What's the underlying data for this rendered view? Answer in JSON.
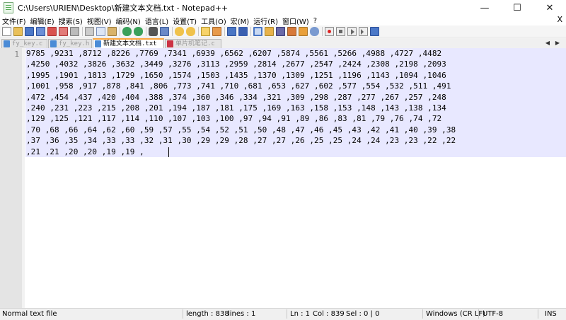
{
  "window": {
    "title": "C:\\Users\\URIEN\\Desktop\\新建文本文档.txt - Notepad++",
    "minimize_glyph": "—",
    "maximize_glyph": "☐",
    "close_glyph": "✕"
  },
  "menu": {
    "items": [
      "文件(F)",
      "编辑(E)",
      "搜索(S)",
      "视图(V)",
      "编码(N)",
      "语言(L)",
      "设置(T)",
      "工具(O)",
      "宏(M)",
      "运行(R)",
      "窗口(W)",
      "?"
    ],
    "close_glyph": "X"
  },
  "toolbar": {
    "icons": [
      "new-file-icon",
      "open-file-icon",
      "save-icon",
      "save-all-icon",
      "close-icon",
      "close-all-icon",
      "print-icon",
      "cut-icon",
      "copy-icon",
      "paste-icon",
      "undo-icon",
      "redo-icon",
      "find-icon",
      "replace-icon",
      "zoom-in-icon",
      "zoom-out-icon",
      "sync-vertical-icon",
      "sync-horizontal-icon",
      "word-wrap-icon",
      "show-all-chars-icon",
      "indent-guide-icon",
      "udl-icon",
      "doc-map-icon",
      "function-list-icon",
      "folder-icon",
      "monitor-icon",
      "record-macro-icon",
      "stop-record-icon",
      "play-macro-icon",
      "run-macro-multiple-icon",
      "save-macro-icon"
    ]
  },
  "tabs": [
    {
      "label": "fy_key.c",
      "active": false
    },
    {
      "label": "fy_key.h",
      "active": false
    },
    {
      "label": "新建文本文档.txt",
      "active": true
    },
    {
      "label": "单片机笔记.c",
      "active": false
    }
  ],
  "editor": {
    "line_number": "1",
    "lines": [
      "9785 ,9231 ,8712 ,8226 ,7769 ,7341 ,6939 ,6562 ,6207 ,5874 ,5561 ,5266 ,4988 ,4727 ,4482",
      ",4250 ,4032 ,3826 ,3632 ,3449 ,3276 ,3113 ,2959 ,2814 ,2677 ,2547 ,2424 ,2308 ,2198 ,2093",
      ",1995 ,1901 ,1813 ,1729 ,1650 ,1574 ,1503 ,1435 ,1370 ,1309 ,1251 ,1196 ,1143 ,1094 ,1046",
      ",1001 ,958 ,917 ,878 ,841 ,806 ,773 ,741 ,710 ,681 ,653 ,627 ,602 ,577 ,554 ,532 ,511 ,491",
      ",472 ,454 ,437 ,420 ,404 ,388 ,374 ,360 ,346 ,334 ,321 ,309 ,298 ,287 ,277 ,267 ,257 ,248",
      ",240 ,231 ,223 ,215 ,208 ,201 ,194 ,187 ,181 ,175 ,169 ,163 ,158 ,153 ,148 ,143 ,138 ,134",
      ",129 ,125 ,121 ,117 ,114 ,110 ,107 ,103 ,100 ,97 ,94 ,91 ,89 ,86 ,83 ,81 ,79 ,76 ,74 ,72",
      ",70 ,68 ,66 ,64 ,62 ,60 ,59 ,57 ,55 ,54 ,52 ,51 ,50 ,48 ,47 ,46 ,45 ,43 ,42 ,41 ,40 ,39 ,38",
      ",37 ,36 ,35 ,34 ,33 ,33 ,32 ,31 ,30 ,29 ,29 ,28 ,27 ,27 ,26 ,25 ,25 ,24 ,24 ,23 ,23 ,22 ,22",
      ",21 ,21 ,20 ,20 ,19 ,19 ,"
    ]
  },
  "status": {
    "file_type": "Normal text file",
    "length": "length : 838",
    "lines": "lines : 1",
    "ln": "Ln : 1",
    "col": "Col : 839",
    "sel": "Sel : 0 | 0",
    "eol": "Windows (CR LF)",
    "encoding": "UTF-8",
    "insert_mode": "INS"
  },
  "colors": {
    "active_tab_accent": "#f9a23a",
    "current_line_bg": "#e8e8ff",
    "gutter_bg": "#e4e4e4",
    "line_number": "#808080"
  }
}
